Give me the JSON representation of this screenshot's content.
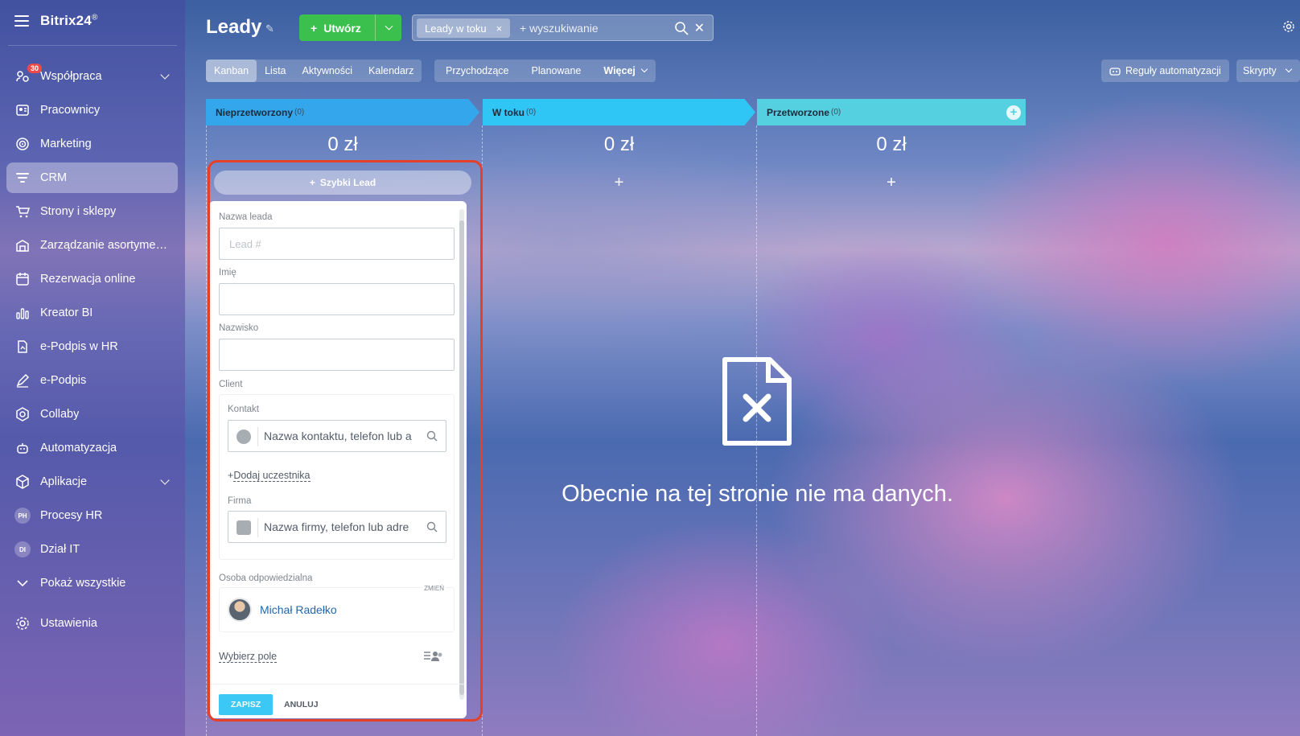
{
  "app": {
    "brand": "Bitrix24",
    "brand_mark": "®"
  },
  "sidebar": {
    "items": [
      {
        "label": "Współpraca",
        "badge": "30",
        "icon": "chat-people-icon",
        "chevron": true
      },
      {
        "label": "Pracownicy",
        "icon": "id-card-icon"
      },
      {
        "label": "Marketing",
        "icon": "target-icon"
      },
      {
        "label": "CRM",
        "icon": "filter-icon",
        "active": true
      },
      {
        "label": "Strony i sklepy",
        "icon": "cart-icon"
      },
      {
        "label": "Zarządzanie asortymen...",
        "icon": "warehouse-icon"
      },
      {
        "label": "Rezerwacja online",
        "icon": "calendar-icon"
      },
      {
        "label": "Kreator BI",
        "icon": "bar-chart-icon"
      },
      {
        "label": "e-Podpis w HR",
        "icon": "document-sign-icon"
      },
      {
        "label": "e-Podpis",
        "icon": "pen-icon"
      },
      {
        "label": "Collaby",
        "icon": "hexagon-icon"
      },
      {
        "label": "Automatyzacja",
        "icon": "robot-icon"
      },
      {
        "label": "Aplikacje",
        "icon": "cube-icon",
        "chevron": true
      },
      {
        "label": "Procesy HR",
        "avatar": "PH"
      },
      {
        "label": "Dział IT",
        "avatar": "DI"
      },
      {
        "label": "Pokaż wszystkie",
        "icon": "chevron-down-icon"
      }
    ],
    "settings_label": "Ustawienia"
  },
  "header": {
    "title": "Leady",
    "create_label": "Utwórz",
    "filter_chip": "Leady w toku",
    "search_placeholder": "+ wyszukiwanie"
  },
  "view_tabs": [
    "Kanban",
    "Lista",
    "Aktywności",
    "Kalendarz"
  ],
  "counter_tabs": [
    "Przychodzące",
    "Planowane"
  ],
  "more_label": "Więcej",
  "automation_label": "Reguły automatyzacji",
  "scripts_label": "Skrypty",
  "columns": [
    {
      "name": "Nieprzetworzony",
      "count": "(0)",
      "sum": "0 zł",
      "color": "#34a7ec"
    },
    {
      "name": "W toku",
      "count": "(0)",
      "sum": "0 zł",
      "color": "#2fc6f6"
    },
    {
      "name": "Przetworzone",
      "count": "(0)",
      "sum": "0 zł",
      "color": "#55d0e0"
    }
  ],
  "quick_lead": {
    "button_label": "Szybki Lead",
    "lead_name_label": "Nazwa leada",
    "lead_name_placeholder": "Lead #",
    "first_name_label": "Imię",
    "last_name_label": "Nazwisko",
    "client_label": "Client",
    "contact_label": "Kontakt",
    "contact_placeholder": "Nazwa kontaktu, telefon lub a",
    "add_member": "Dodaj uczestnika",
    "company_label": "Firma",
    "company_placeholder": "Nazwa firmy, telefon lub adre",
    "responsible_label": "Osoba odpowiedzialna",
    "change_label": "ZMIEŃ",
    "responsible_name": "Michał Radełko",
    "choose_field": "Wybierz pole",
    "save_label": "ZAPISZ",
    "cancel_label": "ANULUJ"
  },
  "empty_state": {
    "message": "Obecnie na tej stronie nie ma danych."
  },
  "colors": {
    "accent_green": "#3bc04e",
    "save_blue": "#3bc8f5",
    "highlight_red": "#e5412a"
  }
}
